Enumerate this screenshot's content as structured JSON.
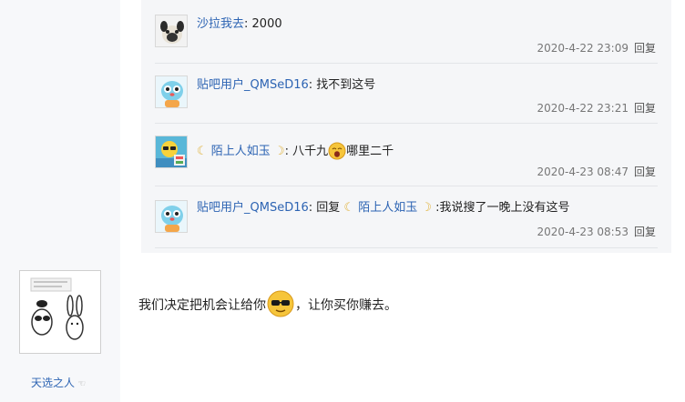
{
  "thread": {
    "replies": [
      {
        "user": "沙拉我去",
        "sep": ": ",
        "content": "2000",
        "time": "2020-4-22 23:09",
        "reply_label": "回复"
      },
      {
        "user": "贴吧用户_QMSeD16",
        "sep": ": ",
        "content": "找不到这号",
        "time": "2020-4-22 23:21",
        "reply_label": "回复"
      },
      {
        "user": "陌上人如玉",
        "sep": ": ",
        "content_a": "八千九",
        "content_b": "哪里二千",
        "time": "2020-4-23 08:47",
        "reply_label": "回复"
      },
      {
        "user": "贴吧用户_QMSeD16",
        "sep": ": ",
        "prefix": "回复",
        "mention": "陌上人如玉",
        "content": ":我说搜了一晚上没有这号",
        "time": "2020-4-23 08:53",
        "reply_label": "回复"
      }
    ]
  },
  "main_post": {
    "user": "天选之人",
    "text_a": "我们决定把机会让给你",
    "text_b": "，让你买你赚去。"
  },
  "icons": {
    "avatar_1": "pug-avatar-icon",
    "avatar_2": "tieba-default-avatar-icon",
    "avatar_3": "sunglasses-avatar-icon",
    "emoji_1": "yawn-emoji-icon",
    "emoji_2": "cool-sunglasses-emoji-icon",
    "decor": "crescent-moon-icon"
  },
  "colors": {
    "username": "#2d64b3",
    "thread_bg": "#f5f6f8",
    "meta": "#777777"
  }
}
